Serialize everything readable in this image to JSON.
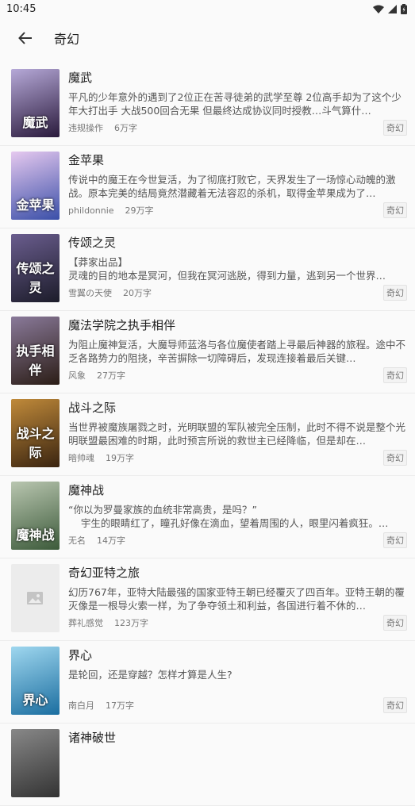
{
  "status": {
    "time": "10:45"
  },
  "header": {
    "title": "奇幻"
  },
  "books": [
    {
      "title": "魔武",
      "cover_text": "魔武",
      "cover_colors": [
        "#2a1a3c",
        "#b6a9d8"
      ],
      "desc": "平凡的少年意外的遇到了2位正在苦寻徒弟的武学至尊 2位高手却为了这个少年大打出手 大战500回合无果 但最终达成协议同时授教…斗气算什…",
      "author": "违规操作",
      "words": "6万字",
      "genre": "奇幻"
    },
    {
      "title": "金苹果",
      "cover_text": "金苹果",
      "cover_colors": [
        "#3a4fa8",
        "#e6c9ef"
      ],
      "desc": "传说中的魔王在今世复活，为了彻底打败它，天界发生了一场惊心动魄的激战。原本完美的结局竟然潜藏着无法容忍的杀机，取得金苹果成为了…",
      "author": "phildonnie",
      "words": "29万字",
      "genre": "奇幻"
    },
    {
      "title": "传颂之灵",
      "cover_text": "传颂之灵",
      "cover_colors": [
        "#1c1c2a",
        "#6a5d8e"
      ],
      "desc": "【莽家出品】\n灵魂的目的地本是冥河，但我在冥河逃脱，得到力量，逃到另一个世界…",
      "author": "雪翼の天使",
      "words": "20万字",
      "genre": "奇幻"
    },
    {
      "title": "魔法学院之执手相伴",
      "cover_text": "执手相伴",
      "cover_colors": [
        "#2b1d16",
        "#8a7a9a"
      ],
      "desc": "为阻止魔神复活，大魔导师蓝洛与各位魔使者踏上寻最后神器的旅程。途中不乏各路势力的阻挠，辛苦摒除一切障碍后，发现连接着最后关键…",
      "author": "风象",
      "words": "27万字",
      "genre": "奇幻"
    },
    {
      "title": "战斗之际",
      "cover_text": "战斗之际",
      "cover_colors": [
        "#3a2410",
        "#c08a3a"
      ],
      "desc": "当世界被魔族屠戮之时，光明联盟的军队被完全压制，此时不得不说是整个光明联盟最困难的时期，此时预言所说的救世主已经降临，但是却在…",
      "author": "暗帅魂",
      "words": "19万字",
      "genre": "奇幻"
    },
    {
      "title": "魔神战",
      "cover_text": "魔神战",
      "cover_colors": [
        "#3c5a3a",
        "#b9c6b0"
      ],
      "desc": "“你以为罗曼家族的血统非常高贵，是吗？”\n    宇生的眼睛红了，瞳孔好像在滴血，望着周围的人，眼里闪着疯狂。…",
      "author": "无名",
      "words": "14万字",
      "genre": "奇幻"
    },
    {
      "title": "奇幻亚特之旅",
      "cover_text": "",
      "cover_colors": [
        "#ececec",
        "#ececec"
      ],
      "desc": "幻历767年，亚特大陆最强的国家亚特王朝已经覆灭了四百年。亚特王朝的覆灭像是一根导火索一样，为了争夺领土和利益，各国进行着不休的…",
      "author": "葬礼感觉",
      "words": "123万字",
      "genre": "奇幻"
    },
    {
      "title": "界心",
      "cover_text": "界心",
      "cover_colors": [
        "#1b6ea0",
        "#9fd7ef"
      ],
      "desc": "是轮回，还是穿越？怎样才算是人生?",
      "author": "南白月",
      "words": "17万字",
      "genre": "奇幻"
    },
    {
      "title": "诸神破世",
      "cover_text": "",
      "cover_colors": [
        "#333",
        "#888"
      ],
      "desc": "",
      "author": "",
      "words": "",
      "genre": ""
    }
  ]
}
